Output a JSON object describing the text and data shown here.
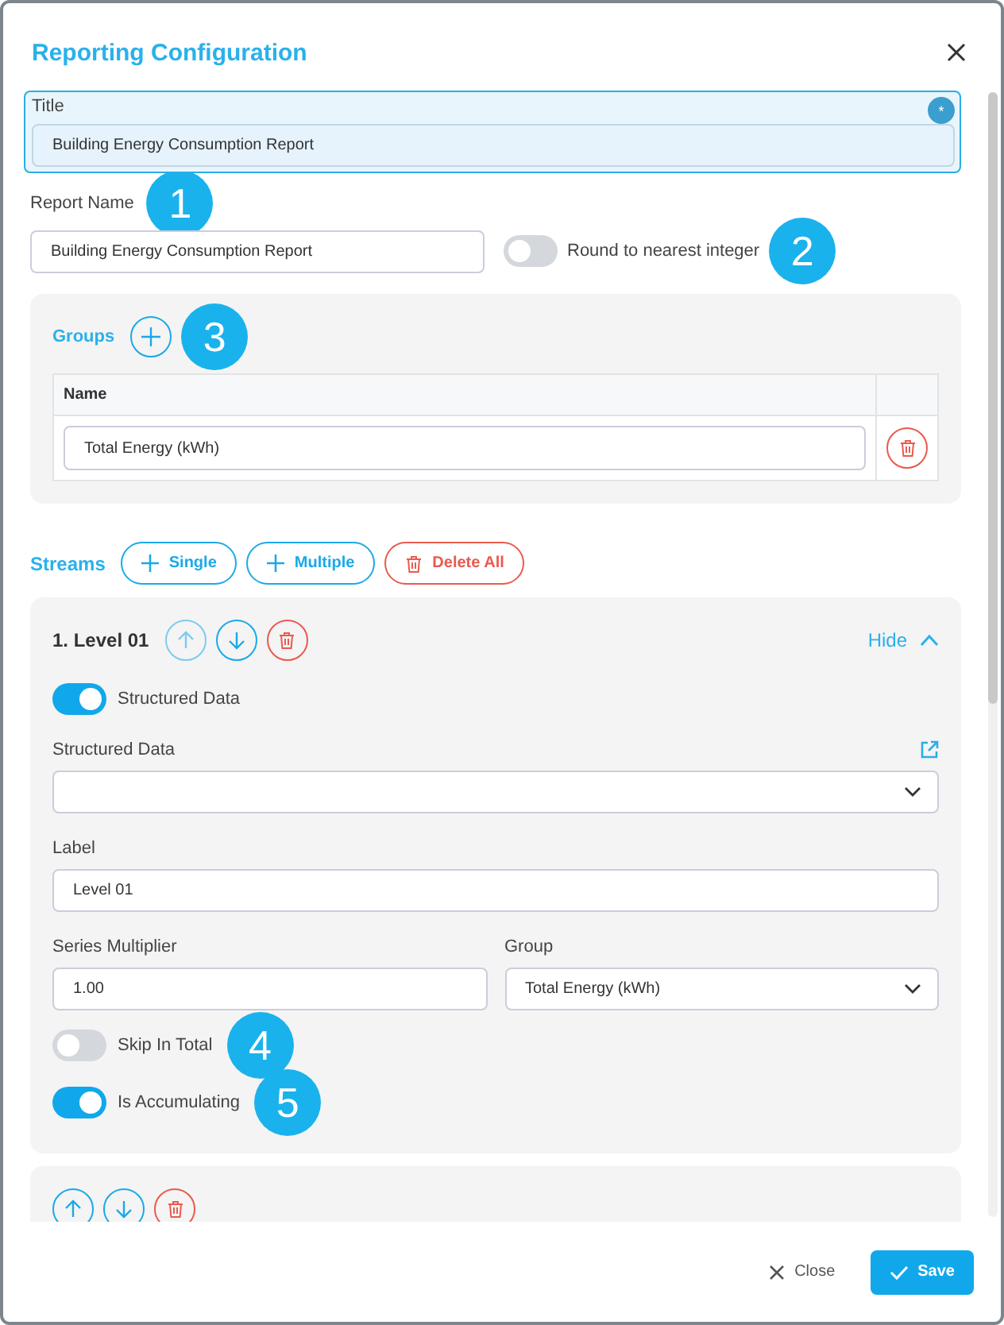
{
  "dialog": {
    "title": "Reporting Configuration"
  },
  "title_field": {
    "label": "Title",
    "value": "Building Energy Consumption Report",
    "badge": "*"
  },
  "report_name": {
    "label": "Report Name",
    "value": "Building Energy Consumption Report",
    "callout": "1"
  },
  "round_toggle": {
    "label": "Round to nearest integer",
    "on": false,
    "callout": "2"
  },
  "groups": {
    "title": "Groups",
    "callout": "3",
    "columns": [
      "Name"
    ],
    "rows": [
      {
        "name": "Total Energy (kWh)"
      }
    ]
  },
  "streams": {
    "title": "Streams",
    "actions": [
      {
        "label": "Single",
        "kind": "add"
      },
      {
        "label": "Multiple",
        "kind": "add"
      },
      {
        "label": "Delete All",
        "kind": "delete"
      }
    ],
    "items": [
      {
        "heading": "1. Level 01",
        "can_move_up": false,
        "expanded": true,
        "toggle_label": "Hide",
        "structured": {
          "label": "Structured Data",
          "on": true
        },
        "structured_data": {
          "label": "Structured Data"
        },
        "label_field": {
          "label": "Label",
          "value": "Level 01"
        },
        "multiplier": {
          "label": "Series Multiplier",
          "value": "1.00"
        },
        "group": {
          "label": "Group",
          "value": "Total Energy (kWh)"
        },
        "toggles": [
          {
            "label": "Skip In Total",
            "on": false,
            "callout": "4"
          },
          {
            "label": "Is Accumulating",
            "on": true,
            "callout": "5"
          }
        ]
      },
      {
        "can_move_up": true
      }
    ]
  },
  "footer": {
    "close": "Close",
    "save": "Save"
  }
}
